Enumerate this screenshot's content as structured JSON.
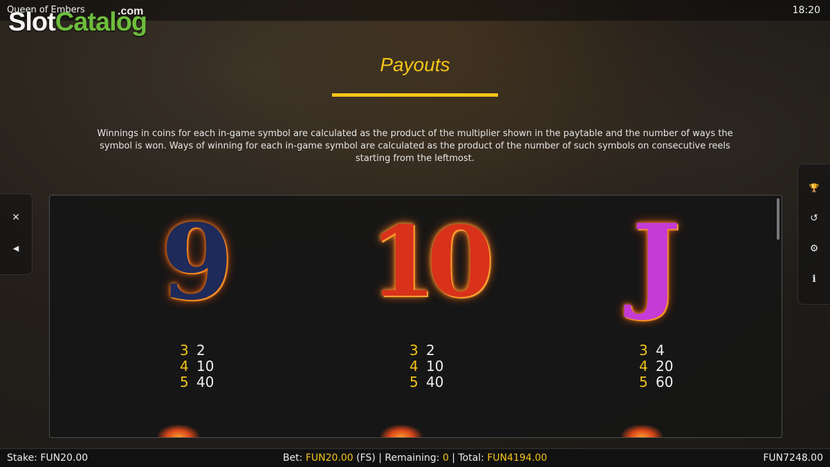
{
  "topbar": {
    "game_title": "Queen of Embers",
    "clock": "18:20"
  },
  "logo": {
    "slot": "Slot",
    "catalog": "Catalog",
    "com": ".com"
  },
  "page": {
    "heading": "Payouts",
    "description": "Winnings in coins for each in-game symbol are calculated as the product of the multiplier shown in the paytable and the number of ways the symbol is won. Ways of winning for each in-game symbol are calculated as the product of the number of such symbols on consecutive reels starting from the leftmost."
  },
  "side_left": {
    "items": [
      {
        "icon": "close-icon",
        "glyph": "✕"
      },
      {
        "icon": "sound-icon",
        "glyph": "◀"
      }
    ]
  },
  "side_right": {
    "items": [
      {
        "icon": "trophy-icon",
        "glyph": "🏆"
      },
      {
        "icon": "history-icon",
        "glyph": "↺"
      },
      {
        "icon": "settings-icon",
        "glyph": "⚙"
      },
      {
        "icon": "info-icon",
        "glyph": "i"
      }
    ]
  },
  "symbols": [
    {
      "name": "9",
      "color": "#1e2a5a",
      "pays": [
        {
          "count": "3",
          "value": "2"
        },
        {
          "count": "4",
          "value": "10"
        },
        {
          "count": "5",
          "value": "40"
        }
      ]
    },
    {
      "name": "10",
      "color": "#d8321a",
      "pays": [
        {
          "count": "3",
          "value": "2"
        },
        {
          "count": "4",
          "value": "10"
        },
        {
          "count": "5",
          "value": "40"
        }
      ]
    },
    {
      "name": "J",
      "color": "#c43bd6",
      "pays": [
        {
          "count": "3",
          "value": "4"
        },
        {
          "count": "4",
          "value": "20"
        },
        {
          "count": "5",
          "value": "60"
        }
      ]
    }
  ],
  "bottombar": {
    "stake_label": "Stake:",
    "stake_value": "FUN20.00",
    "bet_label": "Bet:",
    "bet_value": "FUN20.00",
    "fs": "(FS)",
    "remaining_label": "Remaining:",
    "remaining_value": "0",
    "total_label": "Total:",
    "total_value": "FUN4194.00",
    "balance": "FUN7248.00"
  },
  "colors": {
    "accent": "#f5c518",
    "logo_green": "#6dbd3c"
  }
}
